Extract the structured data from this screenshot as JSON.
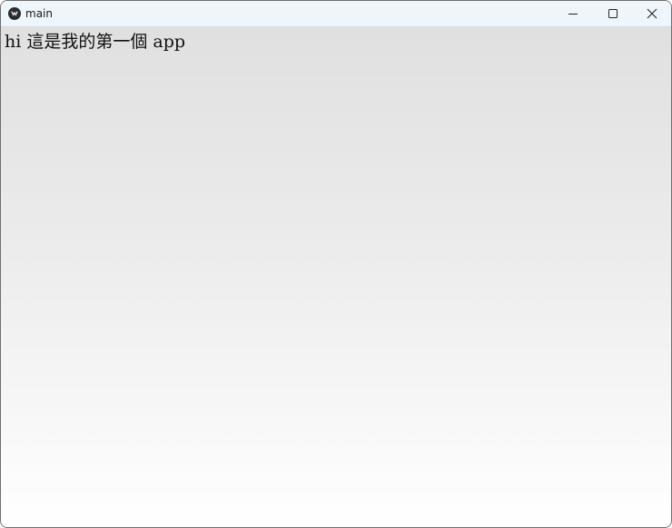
{
  "window": {
    "title": "main",
    "app_icon": "kivy-logo-icon",
    "controls": {
      "minimize": "minimize-icon",
      "maximize": "maximize-icon",
      "close": "close-icon"
    }
  },
  "content": {
    "label_text": "hi 這是我的第一個 app"
  },
  "colors": {
    "titlebar_bg": "#eef6fb",
    "content_top": "#e0e0e0",
    "content_bottom": "#ffffff",
    "text": "#111111"
  }
}
